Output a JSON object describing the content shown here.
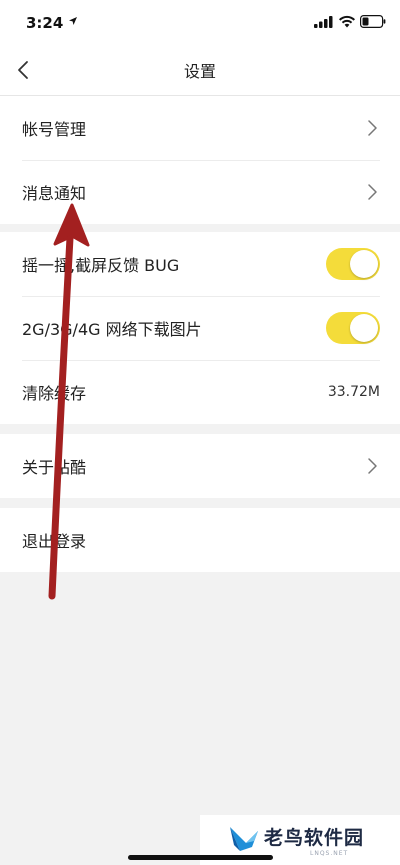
{
  "status_bar": {
    "time": "3:24",
    "icons": [
      "location-arrow-icon",
      "signal-icon",
      "wifi-icon",
      "battery-icon"
    ]
  },
  "nav": {
    "title": "设置",
    "back_icon": "chevron-left-icon"
  },
  "groups": [
    {
      "rows": [
        {
          "label": "帐号管理",
          "accessory": "chevron"
        },
        {
          "label": "消息通知",
          "accessory": "chevron"
        }
      ]
    },
    {
      "rows": [
        {
          "label": "摇一摇,截屏反馈 BUG",
          "accessory": "toggle",
          "on": true
        },
        {
          "label": "2G/3G/4G 网络下载图片",
          "accessory": "toggle",
          "on": true
        },
        {
          "label": "清除缓存",
          "value": "33.72M"
        }
      ]
    },
    {
      "rows": [
        {
          "label": "关于站酷",
          "accessory": "chevron"
        }
      ]
    },
    {
      "rows": [
        {
          "label": "退出登录"
        }
      ]
    }
  ],
  "watermark": {
    "text": "老鸟软件园",
    "sub": "LNQS.NET"
  },
  "colors": {
    "toggle_on": "#f4dc3a",
    "annotation_arrow": "#a32020",
    "background": "#f2f2f2"
  }
}
